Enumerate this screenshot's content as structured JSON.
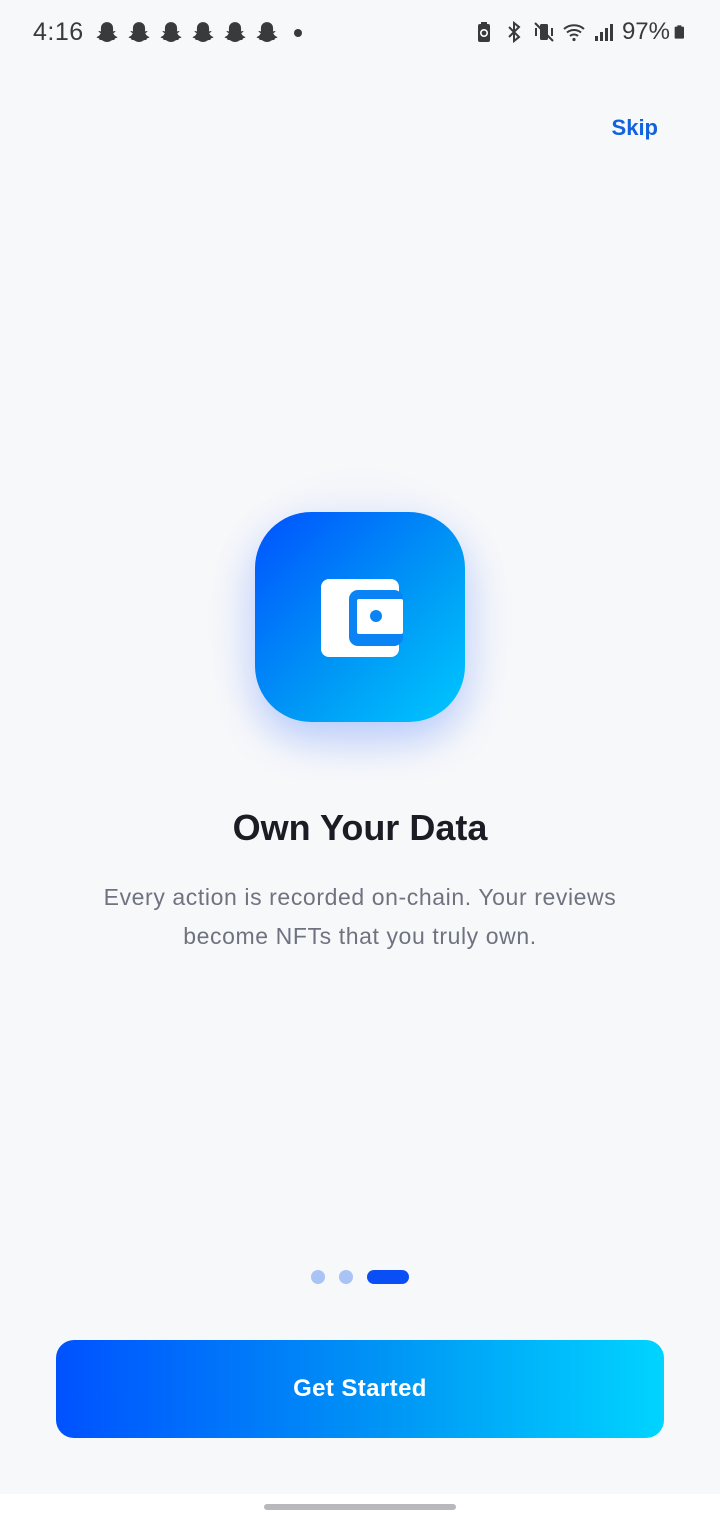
{
  "status_bar": {
    "time": "4:16",
    "notification_icons": [
      "snapchat-icon",
      "snapchat-icon",
      "snapchat-icon",
      "snapchat-icon",
      "snapchat-icon",
      "snapchat-icon"
    ],
    "battery_percent": "97%"
  },
  "header": {
    "skip_label": "Skip"
  },
  "onboarding": {
    "icon": "wallet-icon",
    "title": "Own Your Data",
    "description": "Every action is recorded on-chain. Your reviews become NFTs that you truly own.",
    "page_count": 3,
    "active_page": 3
  },
  "cta": {
    "label": "Get Started"
  },
  "colors": {
    "accent": "#0a4ff5",
    "gradient_start": "#0052ff",
    "gradient_end": "#00d4ff",
    "skip_text": "#1262e0"
  }
}
